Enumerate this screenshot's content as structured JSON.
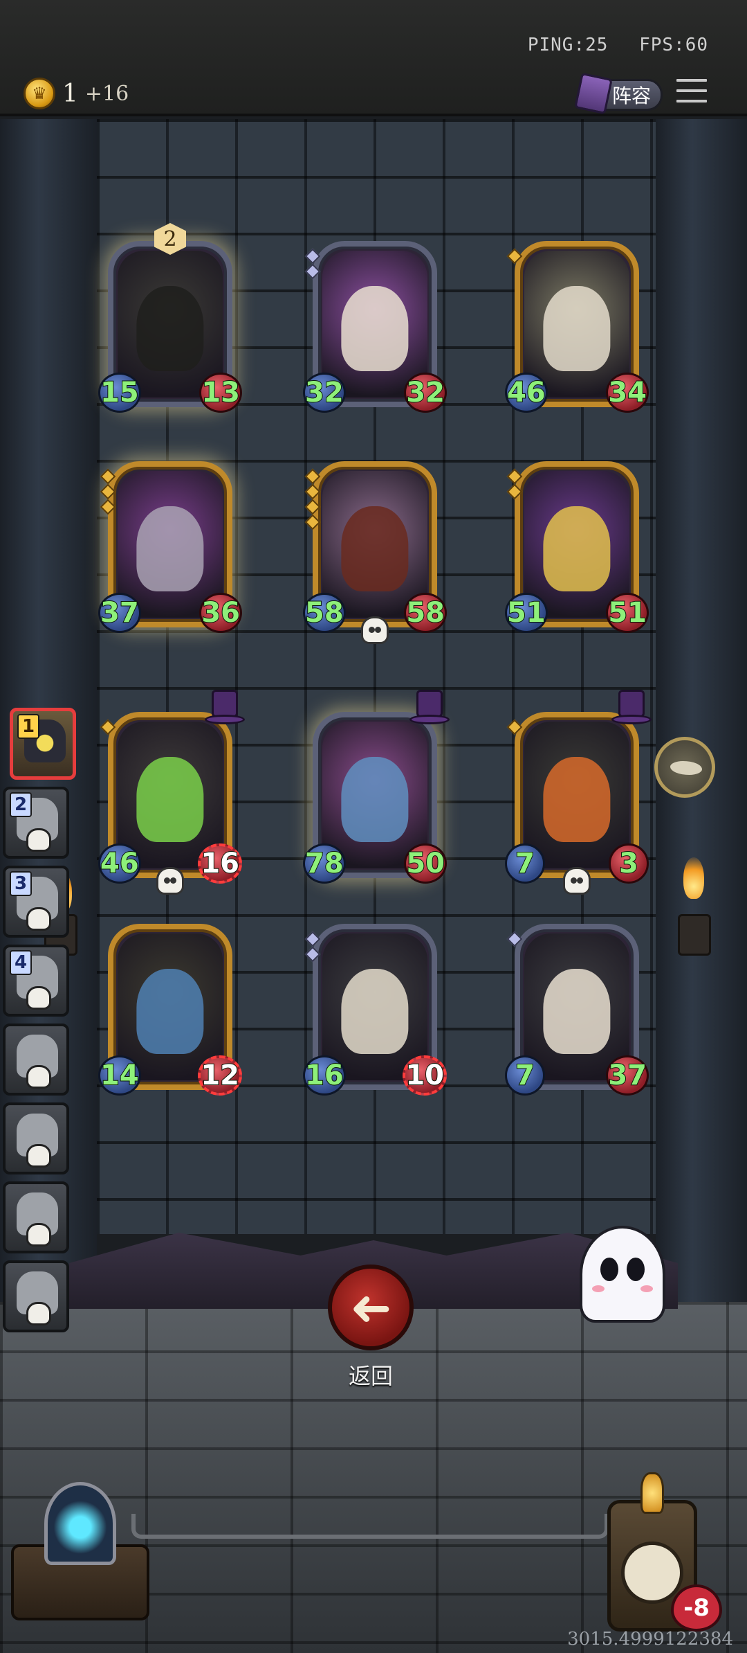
{
  "status": {
    "ping": "PING:25",
    "fps": "FPS:60"
  },
  "economy": {
    "coins": "1",
    "income": "+16"
  },
  "header": {
    "lineup_label": "阵容"
  },
  "board": {
    "minions": [
      {
        "name": "armored-knight",
        "attack": "15",
        "health": "13",
        "frame": "silver",
        "glow": true,
        "level": "2",
        "gems": 0,
        "skull": false,
        "tophat": false,
        "damaged": false,
        "palette": [
          "#3b3a36",
          "#1f1e1c"
        ]
      },
      {
        "name": "white-dragon",
        "attack": "32",
        "health": "32",
        "frame": "silver",
        "glow": false,
        "level": "",
        "gems": 2,
        "skull": false,
        "tophat": false,
        "damaged": false,
        "palette": [
          "#8c4fa0",
          "#e9dfd0"
        ]
      },
      {
        "name": "golden-warrior",
        "attack": "46",
        "health": "34",
        "frame": "gold",
        "glow": false,
        "level": "",
        "gems": 1,
        "skull": false,
        "tophat": false,
        "damaged": false,
        "palette": [
          "#7c7a64",
          "#e4dccb"
        ]
      },
      {
        "name": "shadow-dragon",
        "attack": "37",
        "health": "36",
        "frame": "gold",
        "glow": true,
        "level": "",
        "gems": 3,
        "skull": false,
        "tophat": false,
        "damaged": false,
        "palette": [
          "#7a3e8c",
          "#a9a2b3"
        ]
      },
      {
        "name": "demon-beast",
        "attack": "58",
        "health": "58",
        "frame": "gold",
        "glow": false,
        "level": "",
        "gems": 4,
        "skull": true,
        "tophat": false,
        "damaged": false,
        "palette": [
          "#8a6a8a",
          "#6a2a1e"
        ]
      },
      {
        "name": "fire-sorcerer",
        "attack": "51",
        "health": "51",
        "frame": "gold",
        "glow": false,
        "level": "",
        "gems": 2,
        "skull": false,
        "tophat": false,
        "damaged": false,
        "palette": [
          "#6a3a8c",
          "#e2c04c"
        ]
      },
      {
        "name": "elf-chef",
        "attack": "46",
        "health": "16",
        "frame": "gold",
        "glow": false,
        "level": "",
        "gems": 1,
        "skull": true,
        "tophat": true,
        "damaged": true,
        "palette": [
          "#3e3a3a",
          "#7ad04a"
        ]
      },
      {
        "name": "blue-dragon",
        "attack": "78",
        "health": "50",
        "frame": "silver",
        "glow": true,
        "level": "",
        "gems": 0,
        "skull": false,
        "tophat": true,
        "damaged": false,
        "palette": [
          "#8a4c8c",
          "#5f8fc0"
        ]
      },
      {
        "name": "dragon-rider",
        "attack": "7",
        "health": "3",
        "frame": "gold",
        "glow": false,
        "level": "",
        "gems": 1,
        "skull": true,
        "tophat": true,
        "damaged": false,
        "palette": [
          "#3a3a36",
          "#d76a2a"
        ]
      },
      {
        "name": "baby-blue-dragon",
        "attack": "14",
        "health": "12",
        "frame": "gold",
        "glow": false,
        "level": "",
        "gems": 0,
        "skull": false,
        "tophat": false,
        "damaged": true,
        "palette": [
          "#3c3a30",
          "#4f80b3"
        ]
      },
      {
        "name": "golden-warrior-2",
        "attack": "16",
        "health": "10",
        "frame": "silver",
        "glow": false,
        "level": "",
        "gems": 2,
        "skull": false,
        "tophat": false,
        "damaged": true,
        "palette": [
          "#3c3c40",
          "#e4dccb"
        ]
      },
      {
        "name": "white-dragon-2",
        "attack": "7",
        "health": "37",
        "frame": "silver",
        "glow": false,
        "level": "",
        "gems": 1,
        "skull": false,
        "tophat": false,
        "damaged": false,
        "palette": [
          "#3c3c40",
          "#e9dfd0"
        ]
      }
    ]
  },
  "players": [
    {
      "rank": "1",
      "active": true
    },
    {
      "rank": "2",
      "active": false
    },
    {
      "rank": "3",
      "active": false
    },
    {
      "rank": "4",
      "active": false
    },
    {
      "rank": "",
      "active": false
    },
    {
      "rank": "",
      "active": false
    },
    {
      "rank": "",
      "active": false
    },
    {
      "rank": "",
      "active": false
    }
  ],
  "actions": {
    "return_label": "返回",
    "return_icon": "arrow-left-icon"
  },
  "hud": {
    "health_delta": "-8",
    "seed": "3015.4999122384"
  },
  "colors": {
    "attack": "#8ef07a",
    "health_damaged": "#ff3c3c",
    "gold_frame": "#c08a2a",
    "silver_frame": "#5c6178"
  }
}
